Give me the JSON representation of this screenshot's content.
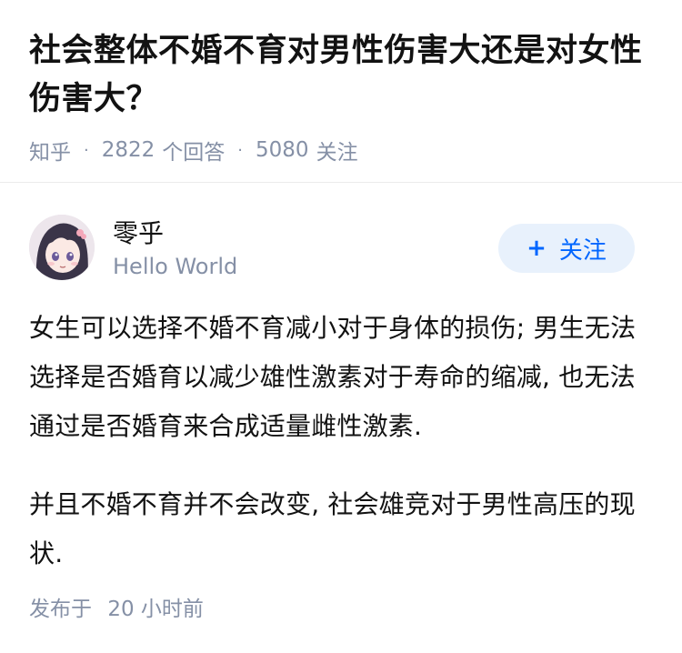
{
  "question": {
    "title": "社会整体不婚不育对男性伤害大还是对女性伤害大？",
    "source": "知乎",
    "answers_count": "2822",
    "answers_label": "个回答",
    "followers_count": "5080",
    "followers_label": "关注"
  },
  "author": {
    "name": "零乎",
    "bio": "Hello World",
    "avatar_icon": "anime-avatar-icon"
  },
  "follow_button": {
    "plus": "+",
    "label": "关注"
  },
  "answer": {
    "paragraphs": [
      "女生可以选择不婚不育减小对于身体的损伤; 男生无法选择是否婚育以减少雄性激素对于寿命的缩减, 也无法通过是否婚育来合成适量雌性激素.",
      "并且不婚不育并不会改变, 社会雄竞对于男性高压的现状."
    ],
    "publish_label": "发布于",
    "publish_time": "20 小时前"
  },
  "colors": {
    "accent": "#0066ff",
    "follow_bg": "#e8f1fc",
    "meta_gray": "#8590a6"
  }
}
